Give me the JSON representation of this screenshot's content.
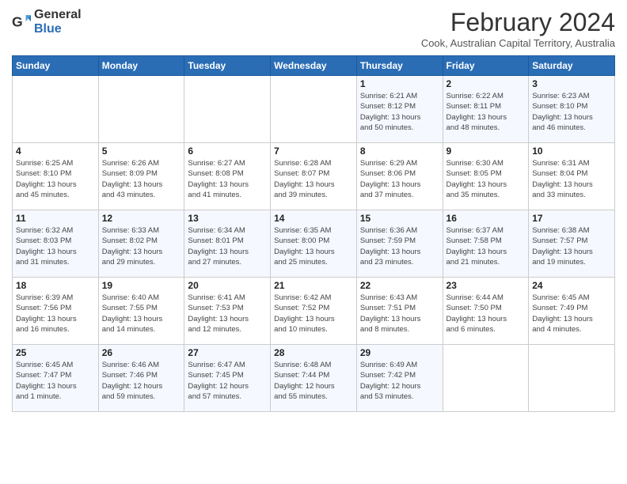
{
  "logo": {
    "general": "General",
    "blue": "Blue"
  },
  "title": "February 2024",
  "subtitle": "Cook, Australian Capital Territory, Australia",
  "days_header": [
    "Sunday",
    "Monday",
    "Tuesday",
    "Wednesday",
    "Thursday",
    "Friday",
    "Saturday"
  ],
  "weeks": [
    [
      {
        "day": "",
        "info": ""
      },
      {
        "day": "",
        "info": ""
      },
      {
        "day": "",
        "info": ""
      },
      {
        "day": "",
        "info": ""
      },
      {
        "day": "1",
        "info": "Sunrise: 6:21 AM\nSunset: 8:12 PM\nDaylight: 13 hours\nand 50 minutes."
      },
      {
        "day": "2",
        "info": "Sunrise: 6:22 AM\nSunset: 8:11 PM\nDaylight: 13 hours\nand 48 minutes."
      },
      {
        "day": "3",
        "info": "Sunrise: 6:23 AM\nSunset: 8:10 PM\nDaylight: 13 hours\nand 46 minutes."
      }
    ],
    [
      {
        "day": "4",
        "info": "Sunrise: 6:25 AM\nSunset: 8:10 PM\nDaylight: 13 hours\nand 45 minutes."
      },
      {
        "day": "5",
        "info": "Sunrise: 6:26 AM\nSunset: 8:09 PM\nDaylight: 13 hours\nand 43 minutes."
      },
      {
        "day": "6",
        "info": "Sunrise: 6:27 AM\nSunset: 8:08 PM\nDaylight: 13 hours\nand 41 minutes."
      },
      {
        "day": "7",
        "info": "Sunrise: 6:28 AM\nSunset: 8:07 PM\nDaylight: 13 hours\nand 39 minutes."
      },
      {
        "day": "8",
        "info": "Sunrise: 6:29 AM\nSunset: 8:06 PM\nDaylight: 13 hours\nand 37 minutes."
      },
      {
        "day": "9",
        "info": "Sunrise: 6:30 AM\nSunset: 8:05 PM\nDaylight: 13 hours\nand 35 minutes."
      },
      {
        "day": "10",
        "info": "Sunrise: 6:31 AM\nSunset: 8:04 PM\nDaylight: 13 hours\nand 33 minutes."
      }
    ],
    [
      {
        "day": "11",
        "info": "Sunrise: 6:32 AM\nSunset: 8:03 PM\nDaylight: 13 hours\nand 31 minutes."
      },
      {
        "day": "12",
        "info": "Sunrise: 6:33 AM\nSunset: 8:02 PM\nDaylight: 13 hours\nand 29 minutes."
      },
      {
        "day": "13",
        "info": "Sunrise: 6:34 AM\nSunset: 8:01 PM\nDaylight: 13 hours\nand 27 minutes."
      },
      {
        "day": "14",
        "info": "Sunrise: 6:35 AM\nSunset: 8:00 PM\nDaylight: 13 hours\nand 25 minutes."
      },
      {
        "day": "15",
        "info": "Sunrise: 6:36 AM\nSunset: 7:59 PM\nDaylight: 13 hours\nand 23 minutes."
      },
      {
        "day": "16",
        "info": "Sunrise: 6:37 AM\nSunset: 7:58 PM\nDaylight: 13 hours\nand 21 minutes."
      },
      {
        "day": "17",
        "info": "Sunrise: 6:38 AM\nSunset: 7:57 PM\nDaylight: 13 hours\nand 19 minutes."
      }
    ],
    [
      {
        "day": "18",
        "info": "Sunrise: 6:39 AM\nSunset: 7:56 PM\nDaylight: 13 hours\nand 16 minutes."
      },
      {
        "day": "19",
        "info": "Sunrise: 6:40 AM\nSunset: 7:55 PM\nDaylight: 13 hours\nand 14 minutes."
      },
      {
        "day": "20",
        "info": "Sunrise: 6:41 AM\nSunset: 7:53 PM\nDaylight: 13 hours\nand 12 minutes."
      },
      {
        "day": "21",
        "info": "Sunrise: 6:42 AM\nSunset: 7:52 PM\nDaylight: 13 hours\nand 10 minutes."
      },
      {
        "day": "22",
        "info": "Sunrise: 6:43 AM\nSunset: 7:51 PM\nDaylight: 13 hours\nand 8 minutes."
      },
      {
        "day": "23",
        "info": "Sunrise: 6:44 AM\nSunset: 7:50 PM\nDaylight: 13 hours\nand 6 minutes."
      },
      {
        "day": "24",
        "info": "Sunrise: 6:45 AM\nSunset: 7:49 PM\nDaylight: 13 hours\nand 4 minutes."
      }
    ],
    [
      {
        "day": "25",
        "info": "Sunrise: 6:45 AM\nSunset: 7:47 PM\nDaylight: 13 hours\nand 1 minute."
      },
      {
        "day": "26",
        "info": "Sunrise: 6:46 AM\nSunset: 7:46 PM\nDaylight: 12 hours\nand 59 minutes."
      },
      {
        "day": "27",
        "info": "Sunrise: 6:47 AM\nSunset: 7:45 PM\nDaylight: 12 hours\nand 57 minutes."
      },
      {
        "day": "28",
        "info": "Sunrise: 6:48 AM\nSunset: 7:44 PM\nDaylight: 12 hours\nand 55 minutes."
      },
      {
        "day": "29",
        "info": "Sunrise: 6:49 AM\nSunset: 7:42 PM\nDaylight: 12 hours\nand 53 minutes."
      },
      {
        "day": "",
        "info": ""
      },
      {
        "day": "",
        "info": ""
      }
    ]
  ]
}
